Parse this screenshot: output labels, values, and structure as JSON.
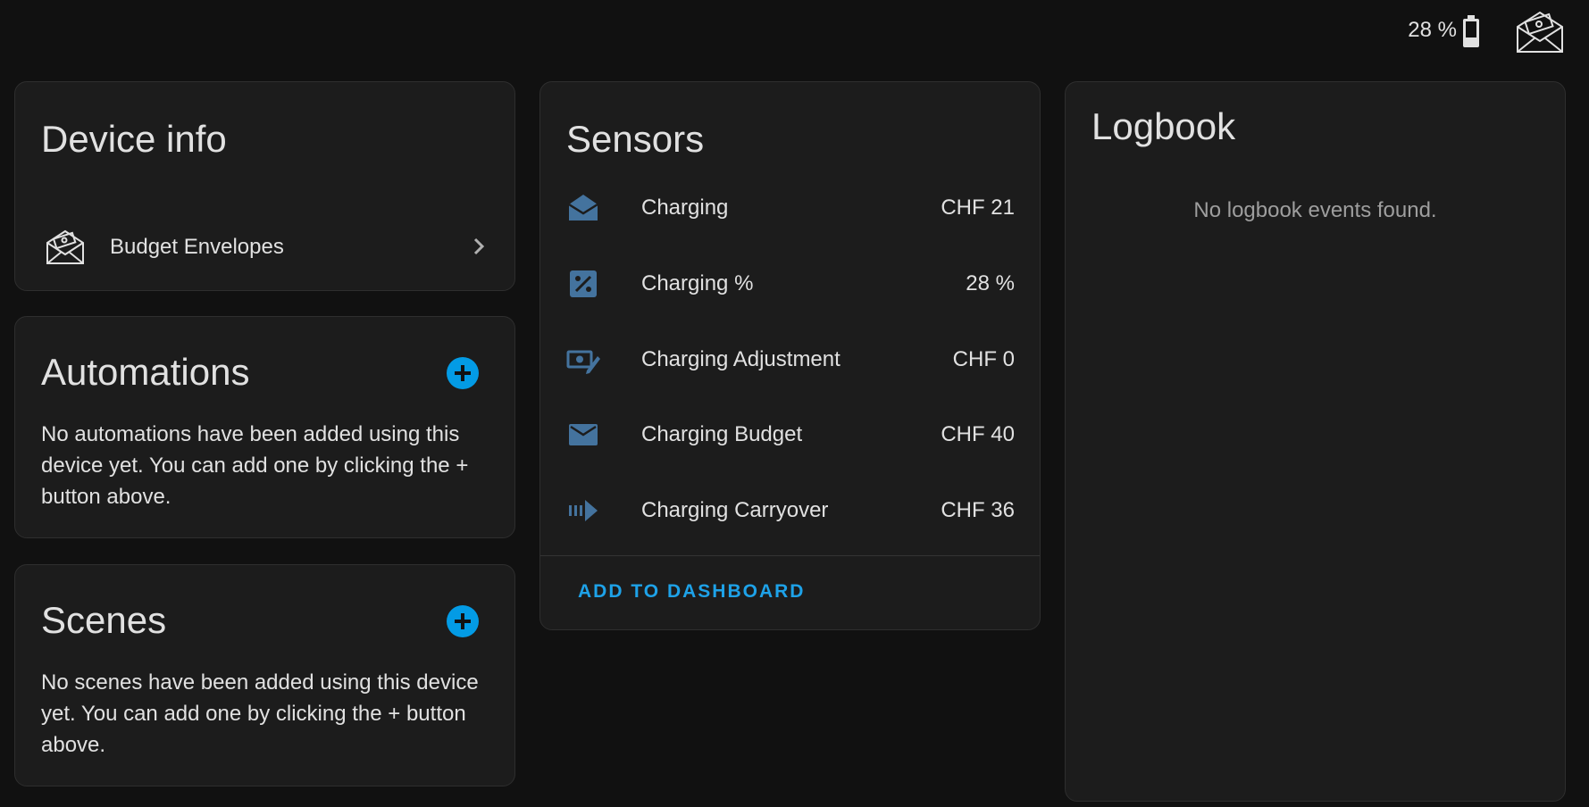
{
  "topbar": {
    "battery_label": "28 %",
    "battery_icon": "battery-icon",
    "device_logo": "budget-envelope-icon"
  },
  "device_info": {
    "title": "Device info",
    "device_name": "Budget Envelopes",
    "device_icon": "budget-envelope-icon",
    "chevron_icon": "chevron-right-icon"
  },
  "automations": {
    "title": "Automations",
    "message": "No automations have been added using this device yet. You can add one by clicking the + button above.",
    "add_icon": "plus-circle-icon"
  },
  "scenes": {
    "title": "Scenes",
    "message": "No scenes have been added using this device yet. You can add one by clicking the + button above.",
    "add_icon": "plus-circle-icon"
  },
  "sensors": {
    "title": "Sensors",
    "items": [
      {
        "label": "Charging",
        "value": "CHF 21",
        "icon": "email-open-icon"
      },
      {
        "label": "Charging %",
        "value": "28 %",
        "icon": "percent-box-icon"
      },
      {
        "label": "Charging Adjustment",
        "value": "CHF 0",
        "icon": "cash-edit-icon"
      },
      {
        "label": "Charging Budget",
        "value": "CHF 40",
        "icon": "email-icon"
      },
      {
        "label": "Charging Carryover",
        "value": "CHF 36",
        "icon": "arrow-right-bold-icon"
      }
    ],
    "add_to_dashboard": "ADD TO DASHBOARD"
  },
  "logbook": {
    "title": "Logbook",
    "empty_message": "No logbook events found."
  },
  "colors": {
    "background": "#111111",
    "card": "#1c1c1c",
    "accent": "#039be5",
    "icon_blue": "#44739e",
    "text": "#e1e1e1"
  }
}
